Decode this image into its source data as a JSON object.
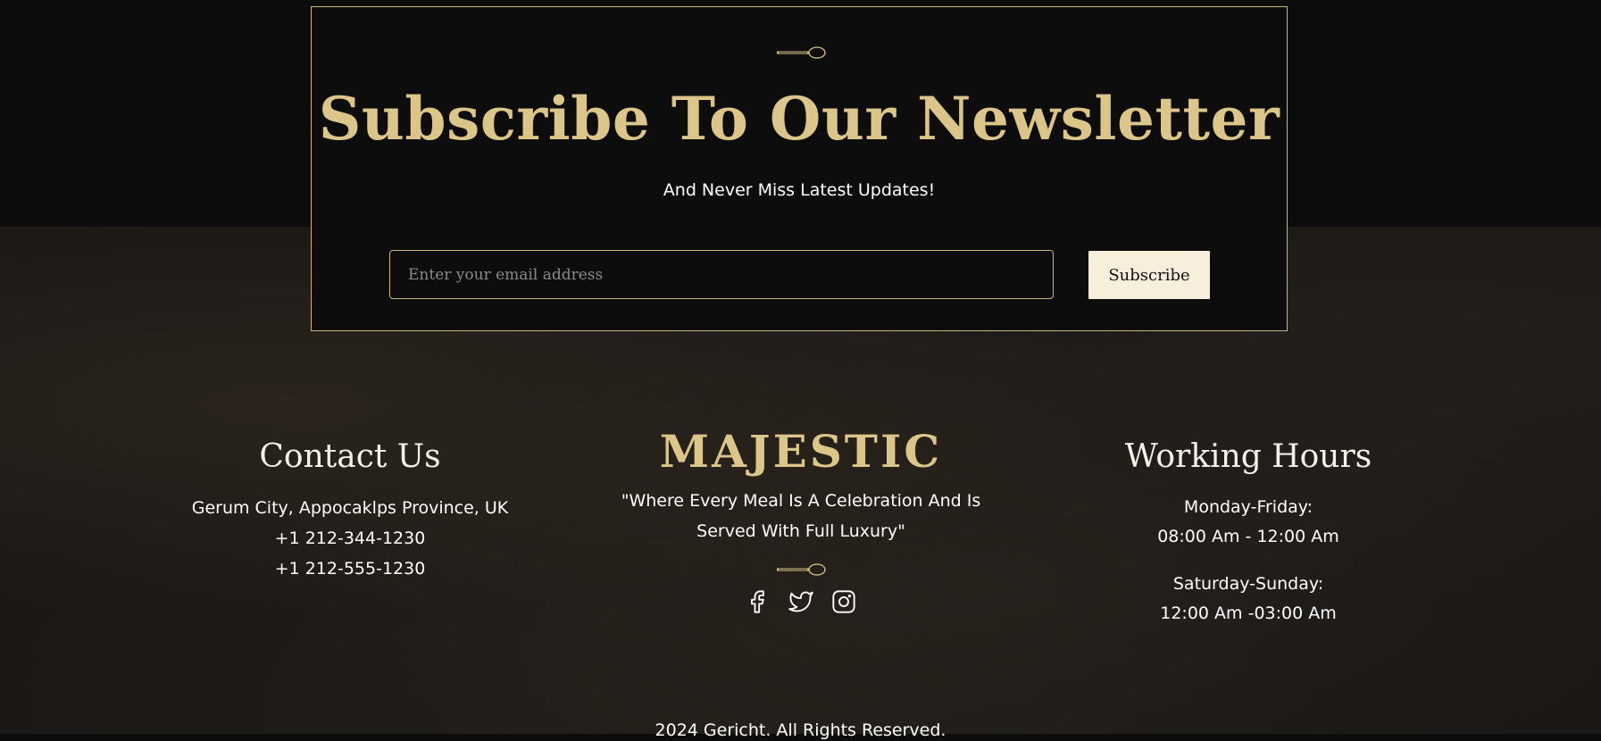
{
  "newsletter": {
    "title": "Subscribe To Our Newsletter",
    "subtitle": "And Never Miss Latest Updates!",
    "email_placeholder": "Enter your email address",
    "email_value": "",
    "subscribe_label": "Subscribe"
  },
  "footer": {
    "contact": {
      "heading": "Contact Us",
      "address": "Gerum City, Appocaklps Province, UK",
      "phone_1": "+1 212-344-1230",
      "phone_2": "+1 212-555-1230"
    },
    "brand": {
      "logo": "MAJESTIC",
      "tagline_line1": "\"Where Every Meal Is A Celebration And Is",
      "tagline_line2": "Served With Full Luxury\"",
      "social_icons": [
        "facebook-icon",
        "twitter-icon",
        "instagram-icon"
      ]
    },
    "hours": {
      "heading": "Working Hours",
      "weekday_label": "Monday-Friday:",
      "weekday_hours": "08:00 Am - 12:00 Am",
      "weekend_label": "Saturday-Sunday:",
      "weekend_hours": "12:00 Am -03:00 Am"
    },
    "copyright": "2024 Gericht. All Rights Reserved."
  },
  "colors": {
    "accent_gold": "#dcc588",
    "border_gold": "#c9b47a",
    "button_cream": "#f7efdc",
    "panel_black": "#0d0d0e"
  }
}
